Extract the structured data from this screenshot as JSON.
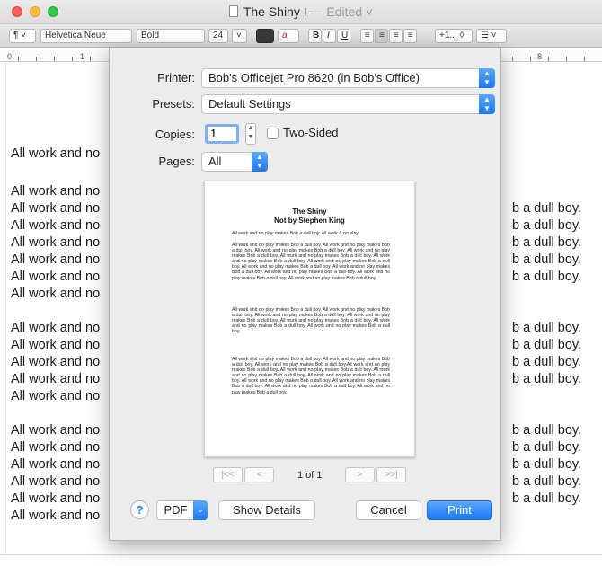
{
  "window": {
    "title": "The Shiny I",
    "title_suffix": " — Edited ˅"
  },
  "toolbar": {
    "paragraph_style": "¶ ˅",
    "font_family": "Helvetica Neue",
    "font_style": "Bold",
    "font_size": "24",
    "size_menu": "˅",
    "text_color_label": "a",
    "bold": "B",
    "italic": "I",
    "underline": "U",
    "spacing": "+1... ◊",
    "list": "☰ ˅"
  },
  "ruler": {
    "left_num": "0",
    "mid_num": "1",
    "right_num": "8"
  },
  "document": {
    "left_lines": [
      "All work and no",
      "All work and no",
      "All work and no",
      "All work and no",
      "All work and no",
      "All work and no",
      "All work and no",
      "All work and no",
      "All work and no",
      "All work and no",
      "All work and no",
      "All work and no",
      "All work and no",
      "All work and no",
      "All work and no",
      "All work and no",
      "All work and no",
      "All work and no",
      "All work and no",
      "All work and no"
    ],
    "right_lines": [
      "b a dull boy.",
      "b a dull boy.",
      "b a dull boy.",
      "b a dull boy.",
      "b a dull boy.",
      "b a dull boy.",
      "b a dull boy.",
      "b a dull boy.",
      "b a dull boy.",
      "b a dull boy.",
      "b a dull boy.",
      "b a dull boy.",
      "b a dull boy.",
      "b a dull boy.",
      "b a dull boy.",
      "b a dull boy."
    ]
  },
  "print_dialog": {
    "printer_label": "Printer:",
    "printer_value": "Bob's Officejet Pro 8620 (in Bob's Office)",
    "presets_label": "Presets:",
    "presets_value": "Default Settings",
    "copies_label": "Copies:",
    "copies_value": "1",
    "two_sided_label": "Two-Sided",
    "pages_label": "Pages:",
    "pages_value": "All",
    "preview": {
      "title": "The Shiny",
      "subtitle": "Not by Stephen King",
      "first_line": "All work and no play makes Bob a dull boy. All work & no play.",
      "paragraph_1": "All work and no play makes Bob a dull boy. All work and no play makes Bob a dull boy. All work and no play makes Bob a dull boy. All work and no play makes Bob a dull boy. All work and no play makes Bob a dull boy. All work and no play makes Bob a dull boy. All work and no play makes Bob a dull boy. All work and no play makes Bob a dull boy. All work and no play makes Bob a dull boy. All work and no play makes Bob a dull boy. All work and no play makes Bob a dull boy. All work and no play makes Bob a dull boy.",
      "paragraph_2": "All work and no play makes Bob a dull boy. All work and no play makes Bob a dull boy. All work and no play makes Bob a dull boy. All work and no play makes Bob a dull boy. All work and no play makes Bob a dull boy. All work and no play makes Bob a dull boy. All work and no play makes Bob a dull boy.",
      "paragraph_3": "All work and no play makes Bob a dull boy. All work and no play makes Bob a dull boy. All work and no play makes Bob a dull boy.All work and no play makes Bob a dull boy. All work and no play makes Bob a dull boy. All work and no play makes Bob a dull boy. All work and no play makes Bob a dull boy. All work and no play makes Bob a dull boy. All work and no play makes Bob a dull boy. All work and no play makes Bob a dull boy. All work and no play makes Bob a dull boy."
    },
    "nav_first": "|<<",
    "nav_prev": "<",
    "page_count": "1 of 1",
    "nav_next": ">",
    "nav_last": ">>|",
    "help_label": "?",
    "pdf_label": "PDF",
    "show_details_label": "Show Details",
    "cancel_label": "Cancel",
    "print_label": "Print"
  }
}
